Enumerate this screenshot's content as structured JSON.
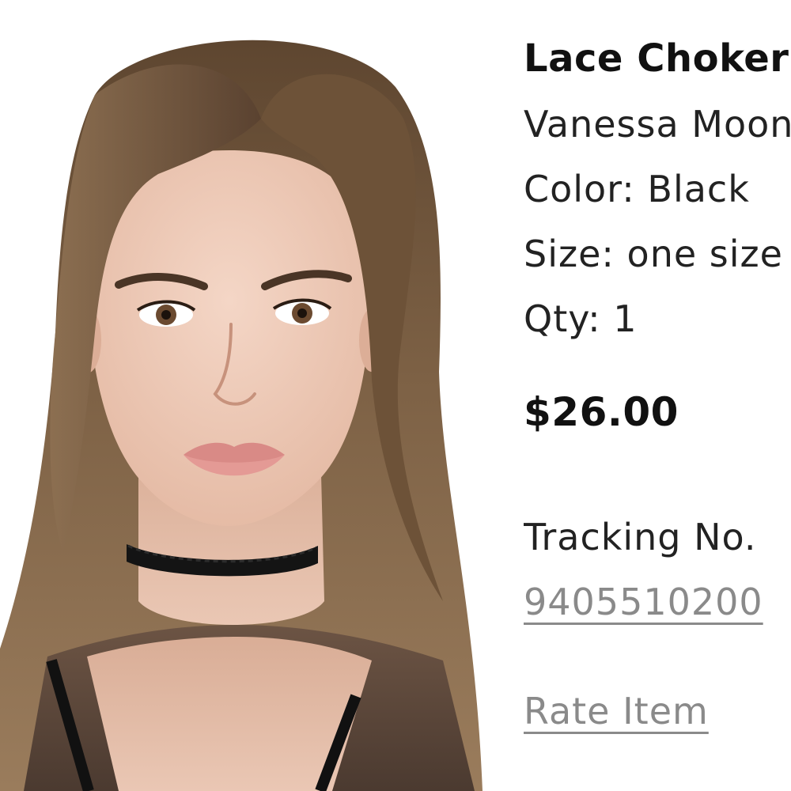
{
  "product": {
    "image_alt": "Model wearing black lace choker",
    "name": "Lace Choker",
    "brand": "Vanessa Mooney",
    "color_line": "Color: Black",
    "size_line": "Size: one size",
    "qty_line": "Qty: 1",
    "price": "$26.00"
  },
  "shipping": {
    "tracking_label": "Tracking No.",
    "tracking_number": "9405510200"
  },
  "actions": {
    "rate_item_label": "Rate Item"
  }
}
